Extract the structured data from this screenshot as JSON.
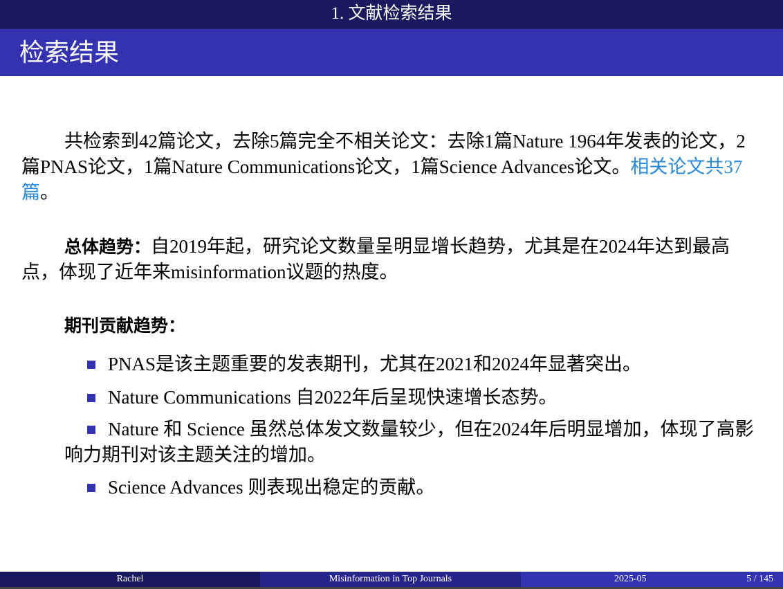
{
  "header": {
    "section": "1. 文献检索结果",
    "title": "检索结果"
  },
  "body": {
    "p1_text": "共检索到42篇论文，去除5篇完全不相关论文：去除1篇Nature 1964年发表的论文，2篇PNAS论文，1篇Nature Communications论文，1篇Science Advances论文。",
    "p1_highlight": "相关论文共37篇",
    "p1_end": "。",
    "p2_label": "总体趋势：",
    "p2_text": "自2019年起，研究论文数量呈明显增长趋势，尤其是在2024年达到最高点，体现了近年来misinformation议题的热度。",
    "journal_heading": "期刊贡献趋势：",
    "bullets": [
      "PNAS是该主题重要的发表期刊，尤其在2021和2024年显著突出。",
      "Nature Communications 自2022年后呈现快速增长态势。",
      "Nature 和 Science 虽然总体发文数量较少，但在2024年后明显增加，体现了高影响力期刊对该主题关注的增加。",
      "Science Advances 则表现出稳定的贡献。"
    ]
  },
  "footer": {
    "author": "Rachel",
    "talk_title": "Misinformation in Top Journals",
    "date": "2025-05",
    "page": "5 / 145"
  },
  "colors": {
    "top_bar": "#1a1a5e",
    "title_bar": "#3333b2",
    "highlight": "#2a88d8"
  }
}
